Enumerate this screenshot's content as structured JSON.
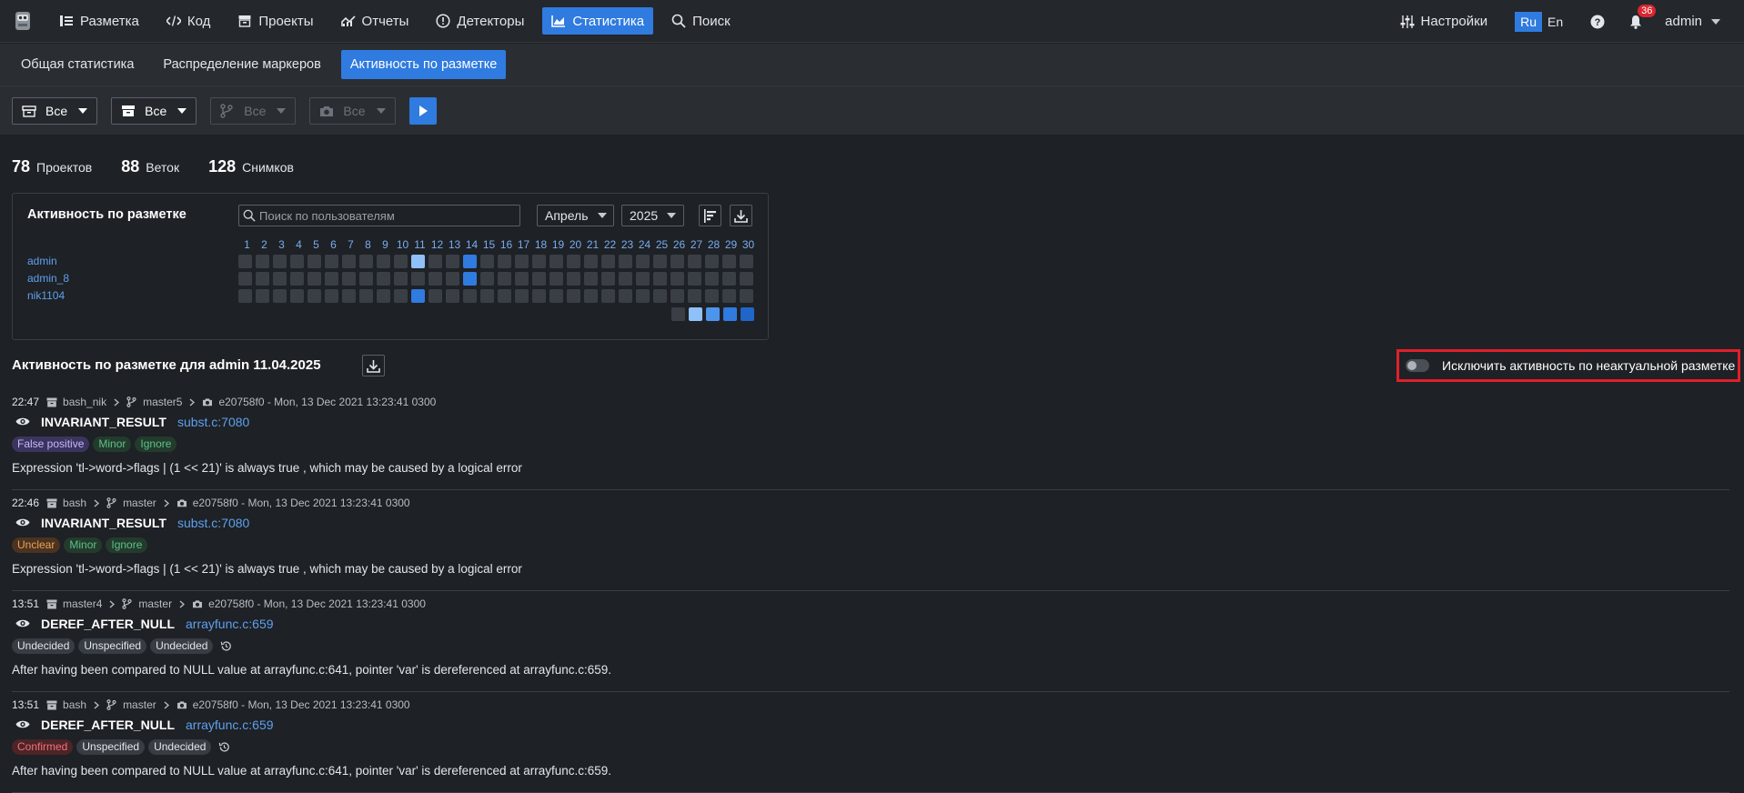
{
  "nav": {
    "items": [
      {
        "label": "Разметка",
        "icon": "list-icon"
      },
      {
        "label": "Код",
        "icon": "code-icon"
      },
      {
        "label": "Проекты",
        "icon": "archive-icon"
      },
      {
        "label": "Отчеты",
        "icon": "report-icon"
      },
      {
        "label": "Детекторы",
        "icon": "alert-icon"
      },
      {
        "label": "Статистика",
        "icon": "chart-icon",
        "active": true
      },
      {
        "label": "Поиск",
        "icon": "search-icon"
      }
    ],
    "settings_label": "Настройки",
    "lang_ru": "Ru",
    "lang_en": "En",
    "notifications_count": "36",
    "user_name": "admin"
  },
  "subnav": {
    "tabs": [
      {
        "label": "Общая статистика"
      },
      {
        "label": "Распределение маркеров"
      },
      {
        "label": "Активность по разметке",
        "active": true
      }
    ]
  },
  "filters": {
    "project": "Все",
    "archive": "Все",
    "branch": "Все",
    "snapshot": "Все"
  },
  "counters": [
    {
      "value": "78",
      "label": "Проектов"
    },
    {
      "value": "88",
      "label": "Веток"
    },
    {
      "value": "128",
      "label": "Снимков"
    }
  ],
  "activity_panel": {
    "title": "Активность по разметке",
    "search_placeholder": "Поиск по пользователям",
    "month": "Апрель",
    "year": "2025",
    "days": [
      "1",
      "2",
      "3",
      "4",
      "5",
      "6",
      "7",
      "8",
      "9",
      "10",
      "11",
      "12",
      "13",
      "14",
      "15",
      "16",
      "17",
      "18",
      "19",
      "20",
      "21",
      "22",
      "23",
      "24",
      "25",
      "26",
      "27",
      "28",
      "29",
      "30"
    ],
    "users": [
      {
        "name": "admin",
        "active_days": {
          "11": 2,
          "14": 4
        }
      },
      {
        "name": "admin_8",
        "active_days": {
          "14": 4
        }
      },
      {
        "name": "nik1104",
        "active_days": {
          "11": 4
        }
      }
    ],
    "legend_levels": 5,
    "colors": {
      "empty": "#3a3f46",
      "level1": "#3a3f46",
      "level2": "#8fc0f7",
      "level3": "#4d94ec",
      "level4": "#2f7be0",
      "level5": "#1f66c8"
    }
  },
  "section": {
    "title": "Активность по разметке для admin 11.04.2025",
    "toggle_label": "Исключить активность по неактуальной разметке"
  },
  "entries": [
    {
      "time": "22:47",
      "project": "bash_nik",
      "branch": "master5",
      "snapshot": "e20758f0 - Mon, 13 Dec 2021 13:23:41 0300",
      "checker": "INVARIANT_RESULT",
      "location": "subst.c:7080",
      "tags": [
        {
          "label": "False positive",
          "kind": "fp"
        },
        {
          "label": "Minor",
          "kind": "minor"
        },
        {
          "label": "Ignore",
          "kind": "ignore"
        }
      ],
      "history": false,
      "message": "Expression 'tl->word->flags | (1 << 21)' is always true , which may be caused by a logical error"
    },
    {
      "time": "22:46",
      "project": "bash",
      "branch": "master",
      "snapshot": "e20758f0 - Mon, 13 Dec 2021 13:23:41 0300",
      "checker": "INVARIANT_RESULT",
      "location": "subst.c:7080",
      "tags": [
        {
          "label": "Unclear",
          "kind": "unclear"
        },
        {
          "label": "Minor",
          "kind": "minor"
        },
        {
          "label": "Ignore",
          "kind": "ignore"
        }
      ],
      "history": false,
      "message": "Expression 'tl->word->flags | (1 << 21)' is always true , which may be caused by a logical error"
    },
    {
      "time": "13:51",
      "project": "master4",
      "branch": "master",
      "snapshot": "e20758f0 - Mon, 13 Dec 2021 13:23:41 0300",
      "checker": "DEREF_AFTER_NULL",
      "location": "arrayfunc.c:659",
      "tags": [
        {
          "label": "Undecided",
          "kind": "plain"
        },
        {
          "label": "Unspecified",
          "kind": "plain"
        },
        {
          "label": "Undecided",
          "kind": "plain"
        }
      ],
      "history": true,
      "message": "After having been compared to NULL value at arrayfunc.c:641, pointer 'var' is dereferenced at arrayfunc.c:659."
    },
    {
      "time": "13:51",
      "project": "bash",
      "branch": "master",
      "snapshot": "e20758f0 - Mon, 13 Dec 2021 13:23:41 0300",
      "checker": "DEREF_AFTER_NULL",
      "location": "arrayfunc.c:659",
      "tags": [
        {
          "label": "Confirmed",
          "kind": "confirmed"
        },
        {
          "label": "Unspecified",
          "kind": "plain"
        },
        {
          "label": "Undecided",
          "kind": "plain"
        }
      ],
      "history": true,
      "message": "After having been compared to NULL value at arrayfunc.c:641, pointer 'var' is dereferenced at arrayfunc.c:659."
    }
  ]
}
